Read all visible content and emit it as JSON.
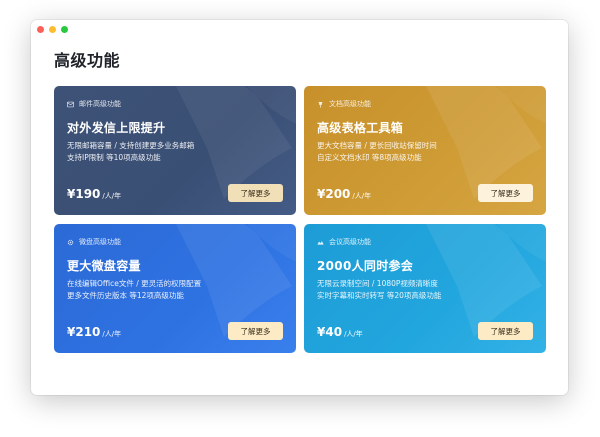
{
  "page": {
    "title": "高级功能"
  },
  "cards": [
    {
      "header": "邮件高级功能",
      "icon": "mail-icon",
      "title": "对外发信上限提升",
      "desc": [
        "无限邮箱容量 / 支持创建更多业务邮箱",
        "支持IP限制 等10项高级功能"
      ],
      "price": "¥190",
      "unit": "/人/年",
      "button": "了解更多"
    },
    {
      "header": "文档高级功能",
      "icon": "pin-icon",
      "title": "高级表格工具箱",
      "desc": [
        "更大文档容量 / 更长回收站保留时间",
        "自定义文档水印 等8项高级功能"
      ],
      "price": "¥200",
      "unit": "/人/年",
      "button": "了解更多"
    },
    {
      "header": "微盘高级功能",
      "icon": "gear-icon",
      "title": "更大微盘容量",
      "desc": [
        "在线编辑Office文件 / 更灵活的权限配置",
        "更多文件历史版本 等12项高级功能"
      ],
      "price": "¥210",
      "unit": "/人/年",
      "button": "了解更多"
    },
    {
      "header": "会议高级功能",
      "icon": "meeting-icon",
      "title": "2000人同时参会",
      "desc": [
        "无限云录制空间 / 1080P视频清晰度",
        "实时字幕和实时转写 等20项高级功能"
      ],
      "price": "¥40",
      "unit": "/人/年",
      "button": "了解更多"
    }
  ]
}
